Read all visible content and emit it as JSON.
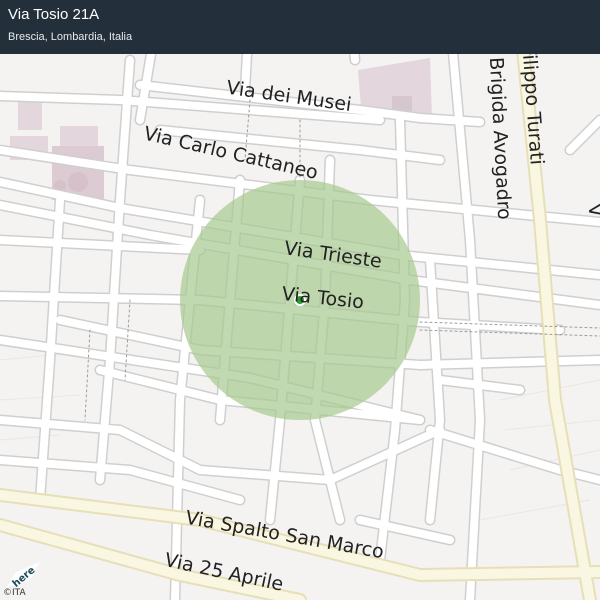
{
  "header": {
    "title": "Via Tosio 21A",
    "subtitle": "Brescia, Lombardia, Italia"
  },
  "map": {
    "streets": [
      {
        "name": "Via dei Musei"
      },
      {
        "name": "Via Carlo Cattaneo"
      },
      {
        "name": "Via Trieste"
      },
      {
        "name": "Via Tosio"
      },
      {
        "name": "Via Spalto San Marco"
      },
      {
        "name": "Via 25 Aprile"
      },
      {
        "name": "Via Filippo Turati"
      },
      {
        "name": "Via Brigida Avogadro"
      }
    ],
    "accuracy_circle_color": "#a7c98f",
    "location_dot_color": "#2e9a2e"
  },
  "attribution": {
    "logo_text": "here",
    "copyright": "©ITA"
  }
}
